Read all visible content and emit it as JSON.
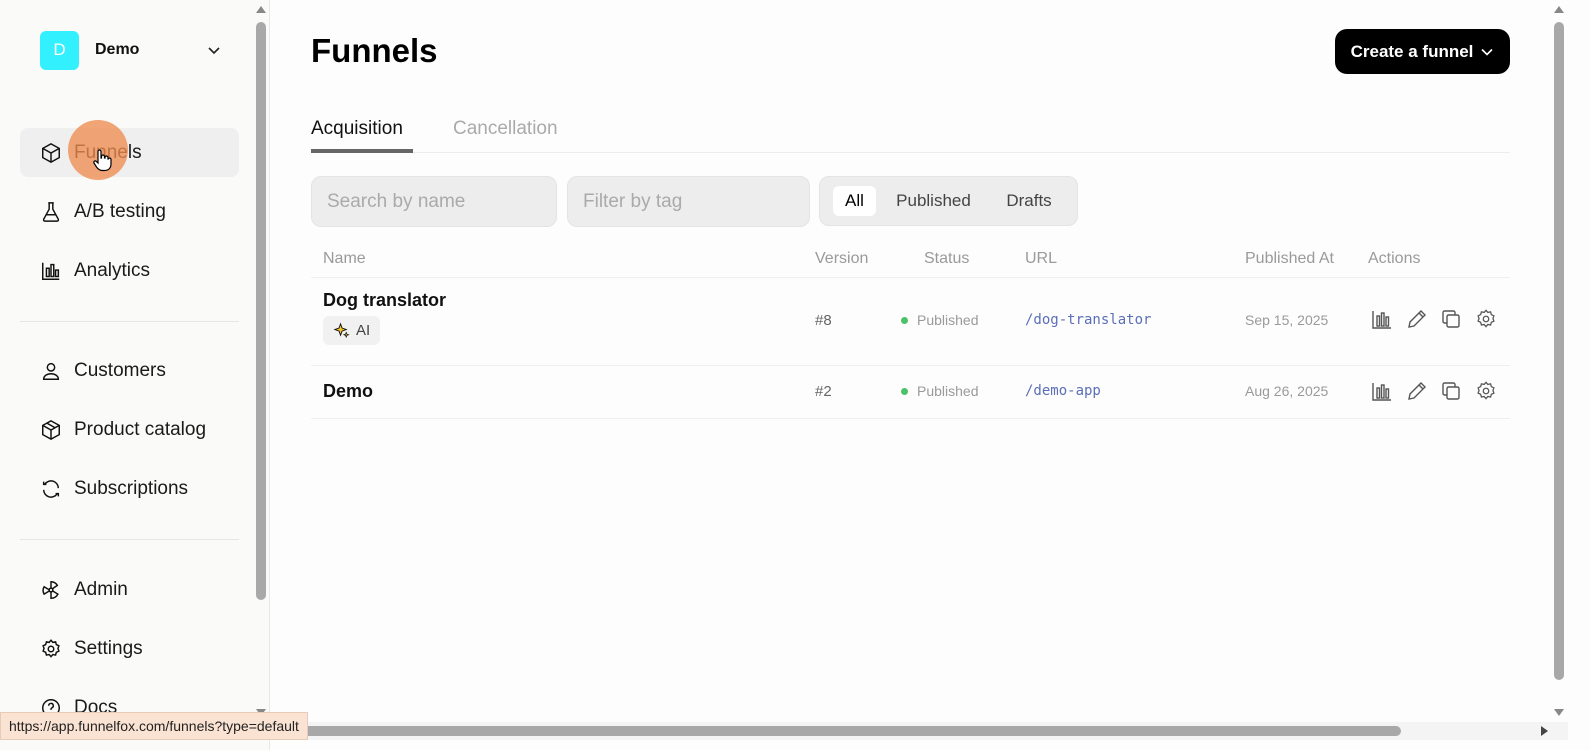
{
  "workspace": {
    "initial": "D",
    "name": "Demo"
  },
  "sidebar": {
    "items": [
      {
        "label": "Funnels",
        "icon": "box-icon",
        "active": true
      },
      {
        "label": "A/B testing",
        "icon": "flask-icon"
      },
      {
        "label": "Analytics",
        "icon": "bar-chart-icon"
      },
      {
        "label": "Customers",
        "icon": "user-icon"
      },
      {
        "label": "Product catalog",
        "icon": "package-icon"
      },
      {
        "label": "Subscriptions",
        "icon": "refresh-icon"
      },
      {
        "label": "Admin",
        "icon": "radiation-icon"
      },
      {
        "label": "Settings",
        "icon": "gear-icon"
      },
      {
        "label": "Docs",
        "icon": "help-circle-icon"
      }
    ]
  },
  "header": {
    "title": "Funnels",
    "create_label": "Create a funnel"
  },
  "tabs": [
    {
      "label": "Acquisition",
      "active": true
    },
    {
      "label": "Cancellation"
    }
  ],
  "filters": {
    "search_placeholder": "Search by name",
    "tag_placeholder": "Filter by tag",
    "segments": [
      {
        "label": "All",
        "selected": true
      },
      {
        "label": "Published"
      },
      {
        "label": "Drafts"
      }
    ]
  },
  "table": {
    "columns": [
      "Name",
      "Version",
      "Status",
      "URL",
      "Published At",
      "Actions"
    ],
    "rows": [
      {
        "name": "Dog translator",
        "tag": "AI",
        "version": "#8",
        "status": "Published",
        "url": "/dog-translator",
        "published_at": "Sep 15, 2025"
      },
      {
        "name": "Demo",
        "version": "#2",
        "status": "Published",
        "url": "/demo-app",
        "published_at": "Aug 26, 2025"
      }
    ]
  },
  "status_bar": {
    "url": "https://app.funnelfox.com/funnels?type=default"
  },
  "colors": {
    "accent": "#000000",
    "workspace_avatar": "#33f0ff",
    "status_published": "#4bc26a",
    "url": "#5b6fb8"
  }
}
